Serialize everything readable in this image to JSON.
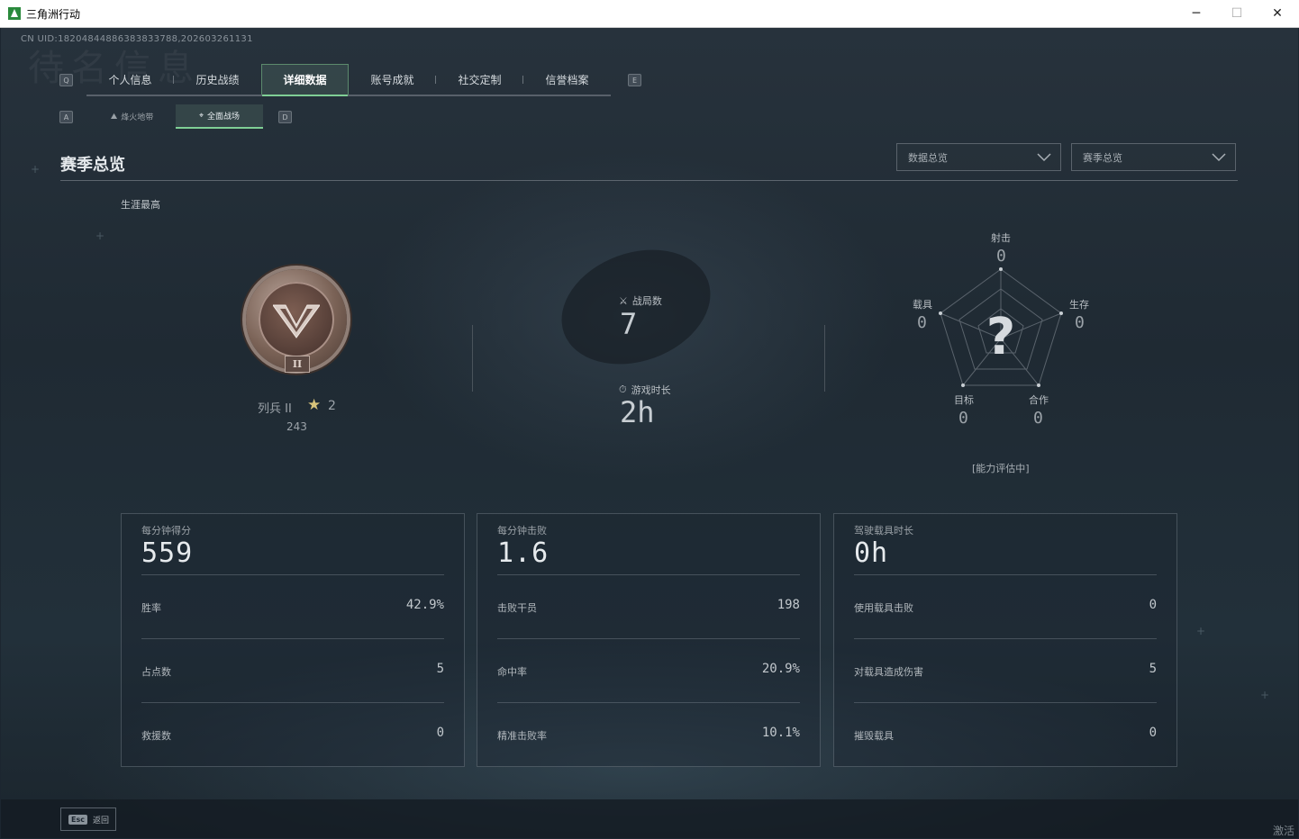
{
  "window": {
    "title": "三角洲行动",
    "minimize": "─",
    "maximize": "☐",
    "close": "✕"
  },
  "uid": "CN UID:18204844886383833788,202603261131",
  "watermark": "待名信息",
  "keys": {
    "tab_left": "Q",
    "tab_right": "E",
    "sub_left": "A",
    "sub_right": "D"
  },
  "tabs": [
    {
      "label": "个人信息"
    },
    {
      "label": "历史战绩"
    },
    {
      "label": "详细数据"
    },
    {
      "label": "账号成就"
    },
    {
      "label": "社交定制"
    },
    {
      "label": "信誉档案"
    }
  ],
  "subtabs": [
    {
      "label": "烽火地带",
      "icon": "mountain-icon"
    },
    {
      "label": "全面战场",
      "icon": "crosshair-icon"
    }
  ],
  "section_title": "赛季总览",
  "dropdowns": [
    {
      "value": "数据总览"
    },
    {
      "value": "赛季总览"
    }
  ],
  "career_label": "生涯最高",
  "rank": {
    "name": "列兵 II",
    "roman": "II",
    "stars": "2",
    "points": "243"
  },
  "matches": {
    "label": "战局数",
    "value": "7"
  },
  "playtime": {
    "label": "游戏时长",
    "value": "2h"
  },
  "radar": {
    "score_glyph": "?",
    "axes": [
      {
        "name": "射击",
        "value": "0"
      },
      {
        "name": "生存",
        "value": "0"
      },
      {
        "name": "合作",
        "value": "0"
      },
      {
        "name": "目标",
        "value": "0"
      },
      {
        "name": "载具",
        "value": "0"
      }
    ],
    "status": "[能力评估中]"
  },
  "cards": [
    {
      "head_label": "每分钟得分",
      "head_value": "559",
      "rows": [
        {
          "label": "胜率",
          "value": "42.9%"
        },
        {
          "label": "占点数",
          "value": "5"
        },
        {
          "label": "救援数",
          "value": "0"
        }
      ]
    },
    {
      "head_label": "每分钟击败",
      "head_value": "1.6",
      "rows": [
        {
          "label": "击败干员",
          "value": "198"
        },
        {
          "label": "命中率",
          "value": "20.9%"
        },
        {
          "label": "精准击败率",
          "value": "10.1%"
        }
      ]
    },
    {
      "head_label": "驾驶载具时长",
      "head_value": "0h",
      "rows": [
        {
          "label": "使用载具击败",
          "value": "0"
        },
        {
          "label": "对载具造成伤害",
          "value": "5"
        },
        {
          "label": "摧毁载具",
          "value": "0"
        }
      ]
    }
  ],
  "footer": {
    "esc_key": "Esc",
    "back_label": "返回",
    "corner_text": "激活"
  },
  "colors": {
    "accent": "#7fcf95",
    "background": "#1f2a33",
    "badge": "#7a6256"
  }
}
